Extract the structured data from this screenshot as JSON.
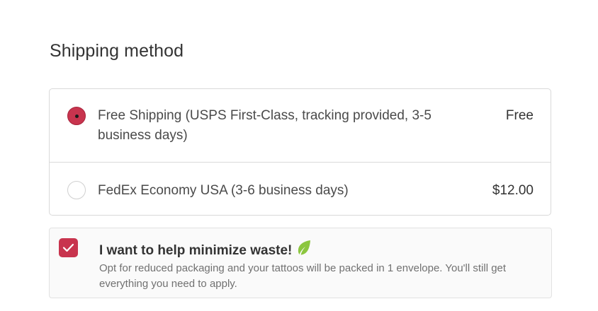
{
  "shipping": {
    "title": "Shipping method",
    "methods": [
      {
        "label": "Free Shipping (USPS First-Class, tracking provided, 3-5 business days)",
        "price": "Free",
        "selected": true
      },
      {
        "label": "FedEx Economy USA (3-6 business days)",
        "price": "$12.00",
        "selected": false
      }
    ]
  },
  "waste_option": {
    "title": "I want to help minimize waste!",
    "icon": "leaf-icon",
    "checked": true,
    "description": "Opt for reduced packaging and your tattoos will be packed in 1 envelope. You'll still get everything you need to apply."
  },
  "colors": {
    "accent": "#c8344e",
    "leaf": "#8cc63f"
  }
}
